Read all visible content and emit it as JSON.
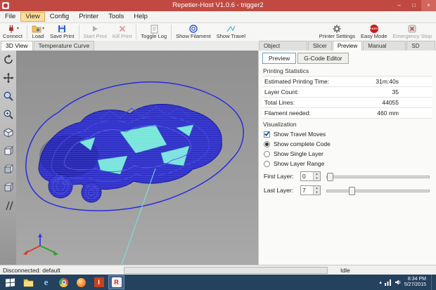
{
  "titlebar": {
    "title": "Repetier-Host V1.0.6 - trigger2",
    "minimize": "–",
    "maximize": "□",
    "close": "×"
  },
  "menu": {
    "items": [
      "File",
      "View",
      "Config",
      "Printer",
      "Tools",
      "Help"
    ]
  },
  "toolbar": {
    "connect": "Connect",
    "load": "Load",
    "save_print": "Save Print",
    "start_print": "Start Print",
    "kill_print": "Kill Print",
    "toggle_log": "Toggle Log",
    "show_filament": "Show Filament",
    "show_travel": "Show Travel",
    "printer_settings": "Printer Settings",
    "easy_mode": "Easy Mode",
    "easy_badge": "EASY",
    "emergency_stop": "Emergency Stop"
  },
  "view_tabs": {
    "view3d": "3D View",
    "temp": "Temperature Curve"
  },
  "right_tabs": {
    "object_placement": "Object Placement",
    "slicer": "Slicer",
    "preview": "Preview",
    "manual_control": "Manual Control",
    "sd_card": "SD Card"
  },
  "preview_panel": {
    "preview_btn": "Preview",
    "gcode_btn": "G-Code Editor",
    "stats_title": "Printing Statistics",
    "stats": [
      {
        "label": "Estimated Printing Time:",
        "value": "31m:40s"
      },
      {
        "label": "Layer Count:",
        "value": "35"
      },
      {
        "label": "Total Lines:",
        "value": "44055"
      },
      {
        "label": "Filament needed:",
        "value": "460 mm"
      }
    ],
    "visualization_title": "Visualization",
    "show_travel_moves": "Show Travel Moves",
    "show_complete_code": "Show complete Code",
    "show_single_layer": "Show Single Layer",
    "show_layer_range": "Show Layer Range",
    "first_layer_label": "First Layer:",
    "first_layer_value": "0",
    "last_layer_label": "Last Layer:",
    "last_layer_value": "7"
  },
  "statusbar": {
    "connection": "Disconnected: default",
    "state": "Idle"
  },
  "taskbar": {
    "time": "8:34 PM",
    "date": "5/27/2015",
    "ie_letter": "e",
    "app_i_letter": "I",
    "repetier_letter": "R"
  },
  "ui": {
    "dropdown": "▾",
    "spin_up": "▲",
    "spin_down": "▼",
    "tray_caret": "▴"
  },
  "colors": {
    "titlebar_red": "#c04a42",
    "print_blue": "#2b2bc4",
    "infill_cyan": "#7ceeda",
    "taskbar_navy": "#24415e"
  }
}
